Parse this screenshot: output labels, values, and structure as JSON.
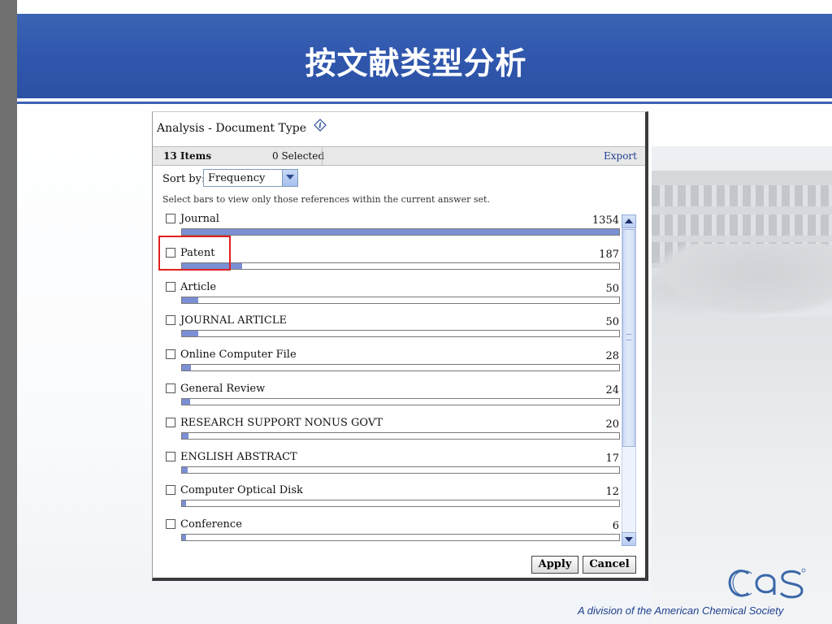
{
  "slide": {
    "title": "按文献类型分析",
    "footer": "A division of the American Chemical Society",
    "logo_text": "CAS",
    "accent_color": "#3057ad",
    "highlight_color": "#e02020"
  },
  "dialog": {
    "title": "Analysis - Document Type",
    "help_icon": "help-diamond-icon",
    "items_count": "13 Items",
    "selected_count": "0 Selected",
    "export_label": "Export",
    "sort_label": "Sort by:",
    "sort_value": "Frequency",
    "instruction": "Select bars to view only those references within the current answer set.",
    "apply_label": "Apply",
    "cancel_label": "Cancel",
    "max_count": 1354,
    "items": [
      {
        "label": "Journal",
        "count": 1354
      },
      {
        "label": "Patent",
        "count": 187
      },
      {
        "label": "Article",
        "count": 50
      },
      {
        "label": "JOURNAL ARTICLE",
        "count": 50
      },
      {
        "label": "Online Computer File",
        "count": 28
      },
      {
        "label": "General Review",
        "count": 24
      },
      {
        "label": "RESEARCH SUPPORT NONUS GOVT",
        "count": 20
      },
      {
        "label": "ENGLISH ABSTRACT",
        "count": 17
      },
      {
        "label": "Computer Optical Disk",
        "count": 12
      },
      {
        "label": "Conference",
        "count": 6
      }
    ]
  }
}
